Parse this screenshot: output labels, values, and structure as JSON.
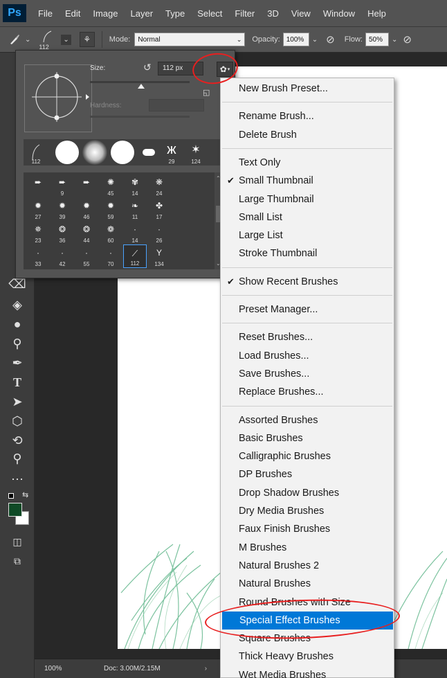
{
  "app": {
    "logo": "Ps"
  },
  "menubar": {
    "items": [
      "File",
      "Edit",
      "Image",
      "Layer",
      "Type",
      "Select",
      "Filter",
      "3D",
      "View",
      "Window",
      "Help"
    ]
  },
  "options": {
    "brush_size": "112",
    "mode_label": "Mode:",
    "mode_value": "Normal",
    "opacity_label": "Opacity:",
    "opacity_value": "100%",
    "flow_label": "Flow:",
    "flow_value": "50%"
  },
  "brush_panel": {
    "size_label": "Size:",
    "size_value": "112 px",
    "hardness_label": "Hardness:",
    "gear_icon": "gear-icon",
    "recent": [
      {
        "label": "112",
        "kind": "stroke"
      },
      {
        "label": "",
        "kind": "hard-round"
      },
      {
        "label": "",
        "kind": "soft-round"
      },
      {
        "label": "",
        "kind": "hard-round"
      },
      {
        "label": "",
        "kind": "eraser"
      },
      {
        "label": "29",
        "kind": "butterfly"
      },
      {
        "label": "124",
        "kind": "star"
      }
    ],
    "grid_rows": [
      [
        "",
        "9",
        "",
        "45",
        "14",
        "24"
      ],
      [
        "27",
        "39",
        "46",
        "59",
        "11",
        "17"
      ],
      [
        "23",
        "36",
        "44",
        "60",
        "14",
        "26"
      ],
      [
        "33",
        "42",
        "55",
        "70",
        "112",
        "134"
      ]
    ],
    "selected_cell": "112"
  },
  "context_menu": {
    "groups": [
      [
        {
          "label": "New Brush Preset...",
          "checked": false
        }
      ],
      [
        {
          "label": "Rename Brush...",
          "checked": false
        },
        {
          "label": "Delete Brush",
          "checked": false
        }
      ],
      [
        {
          "label": "Text Only",
          "checked": false
        },
        {
          "label": "Small Thumbnail",
          "checked": true
        },
        {
          "label": "Large Thumbnail",
          "checked": false
        },
        {
          "label": "Small List",
          "checked": false
        },
        {
          "label": "Large List",
          "checked": false
        },
        {
          "label": "Stroke Thumbnail",
          "checked": false
        }
      ],
      [
        {
          "label": "Show Recent Brushes",
          "checked": true
        }
      ],
      [
        {
          "label": "Preset Manager...",
          "checked": false
        }
      ],
      [
        {
          "label": "Reset Brushes...",
          "checked": false
        },
        {
          "label": "Load Brushes...",
          "checked": false
        },
        {
          "label": "Save Brushes...",
          "checked": false
        },
        {
          "label": "Replace Brushes...",
          "checked": false
        }
      ],
      [
        {
          "label": "Assorted Brushes",
          "checked": false
        },
        {
          "label": "Basic Brushes",
          "checked": false
        },
        {
          "label": "Calligraphic Brushes",
          "checked": false
        },
        {
          "label": "DP Brushes",
          "checked": false
        },
        {
          "label": "Drop Shadow Brushes",
          "checked": false
        },
        {
          "label": "Dry Media Brushes",
          "checked": false
        },
        {
          "label": "Faux Finish Brushes",
          "checked": false
        },
        {
          "label": "M Brushes",
          "checked": false
        },
        {
          "label": "Natural Brushes 2",
          "checked": false
        },
        {
          "label": "Natural Brushes",
          "checked": false
        },
        {
          "label": "Round Brushes with Size",
          "checked": false
        },
        {
          "label": "Special Effect Brushes",
          "checked": false,
          "highlighted": true
        },
        {
          "label": "Square Brushes",
          "checked": false
        },
        {
          "label": "Thick Heavy Brushes",
          "checked": false
        },
        {
          "label": "Wet Media Brushes",
          "checked": false
        }
      ]
    ]
  },
  "status": {
    "zoom": "100%",
    "doc": "Doc: 3.00M/2.15M"
  },
  "colors": {
    "foreground": "#0f4a26",
    "background": "#ffffff",
    "highlight": "#0078d7",
    "annotation": "#e81f1f",
    "grass": "#4fae7e"
  }
}
